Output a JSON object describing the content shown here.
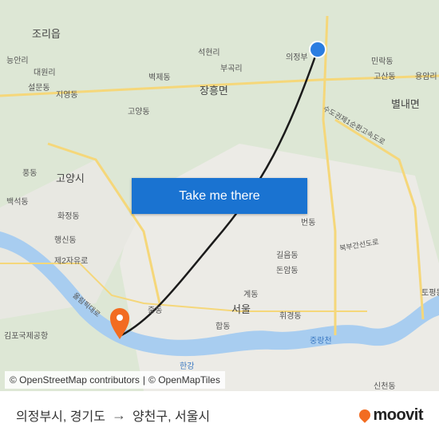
{
  "map": {
    "labels": [
      {
        "text": "조리읍",
        "big": true
      },
      {
        "text": "의정부",
        "big": false
      },
      {
        "text": "장흥면",
        "big": true
      },
      {
        "text": "고양시",
        "big": true
      },
      {
        "text": "서울",
        "big": true
      },
      {
        "text": "별내면",
        "big": true
      },
      {
        "text": "한강",
        "water": true
      },
      {
        "text": "중랑천",
        "water": true
      },
      {
        "text": "김포국제공항",
        "big": false
      },
      {
        "text": "제2자유로",
        "big": false
      },
      {
        "text": "석현리",
        "big": false
      },
      {
        "text": "부곡리",
        "big": false
      },
      {
        "text": "벽제동",
        "big": false
      },
      {
        "text": "고양동",
        "big": false
      },
      {
        "text": "지영동",
        "big": false
      },
      {
        "text": "설문동",
        "big": false
      },
      {
        "text": "대원리",
        "big": false
      },
      {
        "text": "능안리",
        "big": false
      },
      {
        "text": "풍동",
        "big": false
      },
      {
        "text": "백석동",
        "big": false
      },
      {
        "text": "행신동",
        "big": false
      },
      {
        "text": "화정동",
        "big": false
      },
      {
        "text": "민락동",
        "big": false
      },
      {
        "text": "고산동",
        "big": false
      },
      {
        "text": "용암리",
        "big": false
      },
      {
        "text": "번동",
        "big": false
      },
      {
        "text": "길음동",
        "big": false
      },
      {
        "text": "돈암동",
        "big": false
      },
      {
        "text": "계동",
        "big": false
      },
      {
        "text": "휘경동",
        "big": false
      },
      {
        "text": "합동",
        "big": false
      },
      {
        "text": "중동",
        "big": false
      },
      {
        "text": "신천동",
        "big": false
      },
      {
        "text": "토평동",
        "big": false
      },
      {
        "text": "수도권제1순환고속도로",
        "big": false
      },
      {
        "text": "북부간선도로",
        "big": false
      },
      {
        "text": "올림픽대로",
        "big": false
      }
    ],
    "colors": {
      "route": "#1b1b1b",
      "origin": "#2a7de1",
      "destination": "#f26c21",
      "water": "#a8cdf0",
      "button": "#1a73d1"
    }
  },
  "cta": {
    "label": "Take me there"
  },
  "attribution": {
    "osm": "© OpenStreetMap contributors",
    "sep": "|",
    "tiles": "© OpenMapTiles"
  },
  "footer": {
    "origin": "의정부시, 경기도",
    "arrow": "→",
    "destination": "양천구, 서울시",
    "brand": "moovit"
  }
}
